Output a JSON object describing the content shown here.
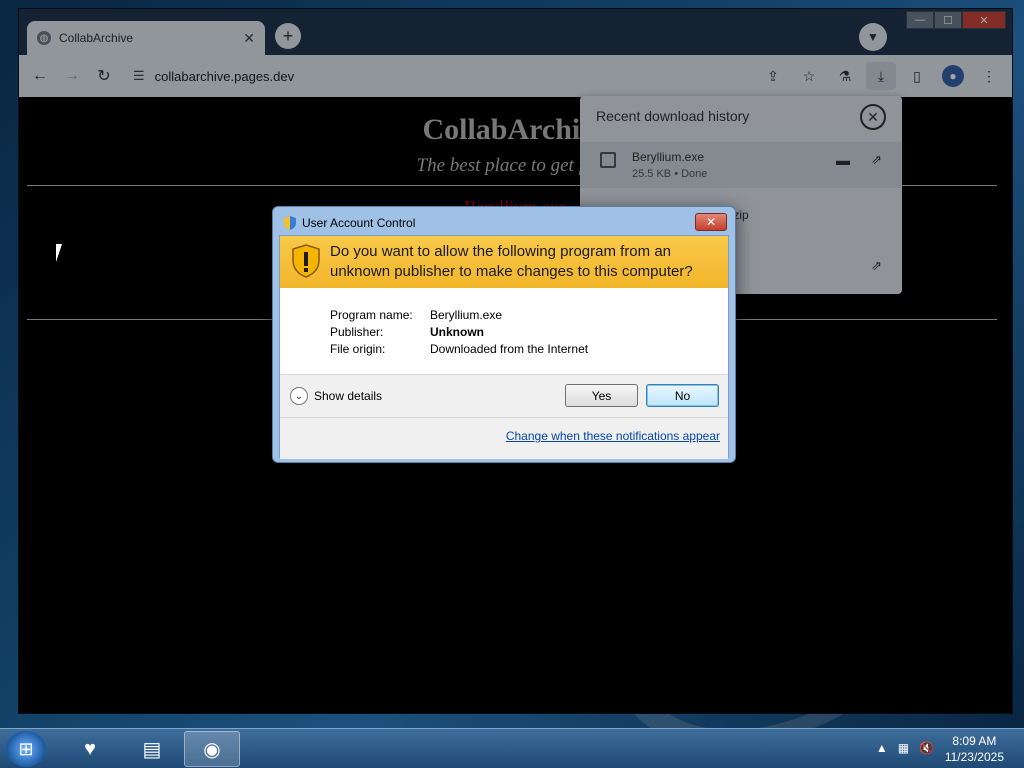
{
  "browser": {
    "tab_title": "CollabArchive",
    "tab_close": "✕",
    "new_tab": "+",
    "url": "collabarchive.pages.dev"
  },
  "page": {
    "title": "CollabArchive",
    "subtitle": "The best place to get forki",
    "download_link": "Beryllium.exe"
  },
  "downloads_panel": {
    "heading": "Recent download history",
    "items": [
      {
        "name": "Beryllium.exe",
        "meta": "25.5 KB • Done"
      },
      {
        "name": ".zip",
        "meta": ""
      }
    ]
  },
  "uac": {
    "title": "User Account Control",
    "question": "Do you want to allow the following program from an unknown publisher to make changes to this computer?",
    "fields": [
      {
        "label": "Program name:",
        "value": "Beryllium.exe"
      },
      {
        "label": "Publisher:",
        "value": "Unknown"
      },
      {
        "label": "File origin:",
        "value": "Downloaded from the Internet"
      }
    ],
    "show_details": "Show details",
    "yes": "Yes",
    "no": "No",
    "change_link": "Change when these notifications appear"
  },
  "taskbar": {
    "time": "8:09 AM",
    "date": "11/23/2025"
  },
  "colors": {
    "uac_banner": "#f8c94a",
    "link": "#0645ad",
    "page_link": "#d00000"
  }
}
